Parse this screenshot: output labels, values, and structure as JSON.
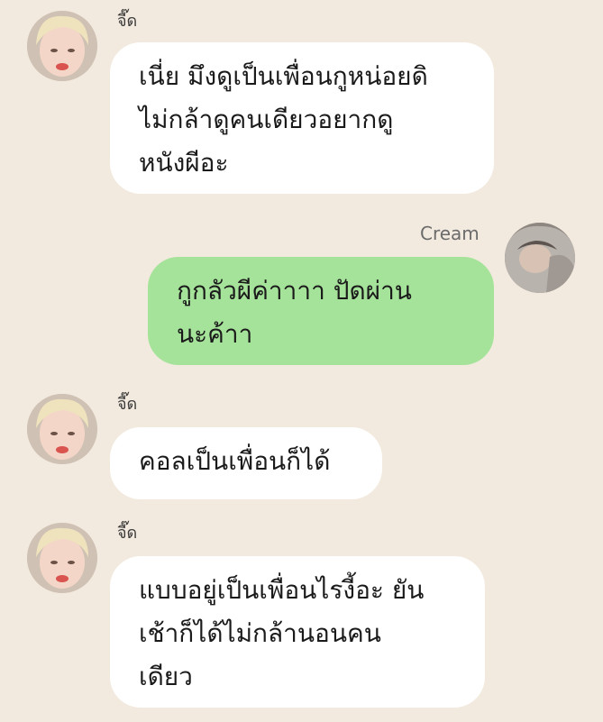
{
  "colors": {
    "background": "#f3eadf",
    "incoming_bubble": "#ffffff",
    "outgoing_bubble": "#a6e39a",
    "name_text": "#3a3a3a"
  },
  "messages": [
    {
      "direction": "incoming",
      "sender": "จี๊ด",
      "avatar": "blond-boy-avatar",
      "text": "เนี่ย มึงดูเป็นเพื่อนกูหน่อยดิ\nไม่กล้าดูคนเดียวอยากดู\nหนังผีอะ"
    },
    {
      "direction": "outgoing",
      "sender": "Cream",
      "avatar": "fur-hood-avatar",
      "text": "กูกลัวผีค่าาาา ปัดผ่าน\nนะค้าา"
    },
    {
      "direction": "incoming",
      "sender": "จี๊ด",
      "avatar": "blond-boy-avatar",
      "text": "คอลเป็นเพื่อนก็ได้"
    },
    {
      "direction": "incoming",
      "sender": "จี๊ด",
      "avatar": "blond-boy-avatar",
      "text": "แบบอยู่เป็นเพื่อนไรงี้อะ ยัน\nเช้าก็ได้ไม่กล้านอนคน\nเดียว"
    }
  ]
}
